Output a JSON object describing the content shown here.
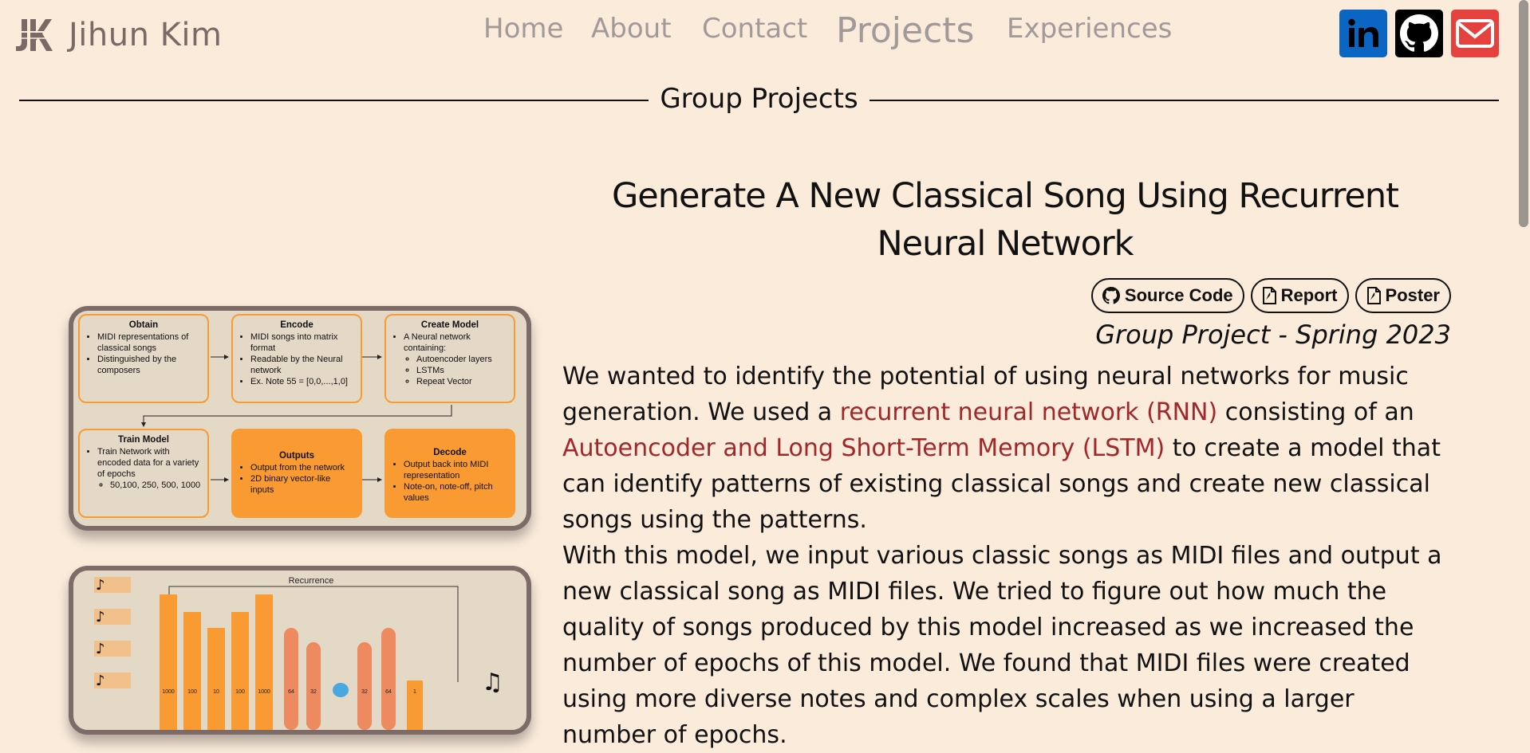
{
  "site": {
    "name": "Jihun Kim",
    "logo_text": "JK"
  },
  "nav": [
    {
      "label": "Home",
      "active": false
    },
    {
      "label": "About",
      "active": false
    },
    {
      "label": "Contact",
      "active": false
    },
    {
      "label": "Projects",
      "active": true
    },
    {
      "label": "Experiences",
      "active": false
    }
  ],
  "social": {
    "icons": [
      "linkedin-icon",
      "github-icon",
      "mail-icon"
    ],
    "colors": {
      "linkedin": "#0a66c2",
      "github": "#000000",
      "mail": "#e5413f"
    }
  },
  "section": {
    "title": "Group Projects"
  },
  "project": {
    "title": "Generate A New Classical Song Using Recurrent Neural Network",
    "buttons": [
      {
        "label": "Source Code",
        "icon": "github-icon"
      },
      {
        "label": "Report",
        "icon": "pdf-icon"
      },
      {
        "label": "Poster",
        "icon": "pdf-icon"
      }
    ],
    "subtitle": "Group Project - Spring 2023",
    "p1_a": "We wanted to identify the potential of using neural networks for music generation. We used a ",
    "p1_hl1": "recurrent neural network (RNN)",
    "p1_b": " consisting of an ",
    "p1_hl2": "Autoencoder and Long Short-Term Memory (LSTM)",
    "p1_c": " to create a model that can identify patterns of existing classical songs and create new classical songs using the patterns.",
    "p2": "With this model, we input various classic songs as MIDI files and output a new classical song as MIDI files. We tried to figure out how much the quality of songs produced by this model increased as we increased the number of epochs of this model. We found that MIDI files were created using more diverse notes and complex scales when using a larger number of epochs.",
    "accent_color": "#a0282a"
  },
  "flowchart": {
    "obtain": {
      "title": "Obtain",
      "items": [
        "MIDI representations of classical songs",
        "Distinguished by the composers"
      ]
    },
    "encode": {
      "title": "Encode",
      "items": [
        "MIDI songs into matrix format",
        "Readable by the Neural network",
        "Ex. Note 55 = [0,0,...,1,0]"
      ]
    },
    "create": {
      "title": "Create Model",
      "items": [
        "A Neural network containing:"
      ],
      "sub": [
        "Autoencoder layers",
        "LSTMs",
        "Repeat Vector"
      ]
    },
    "train": {
      "title": "Train Model",
      "items": [
        "Train Network with encoded data for a variety of epochs"
      ],
      "sub": [
        "50,100, 250, 500, 1000"
      ]
    },
    "outputs": {
      "title": "Outputs",
      "items": [
        "Output from the network",
        "2D binary vector-like inputs"
      ]
    },
    "decode": {
      "title": "Decode",
      "items": [
        "Output back into MIDI representation",
        "Note-on, note-off, pitch values"
      ]
    }
  },
  "network": {
    "recurrence_label": "Recurrence",
    "layers": [
      "1000",
      "100",
      "10",
      "100",
      "1000",
      "64",
      "32",
      "",
      "32",
      "64",
      "1"
    ]
  }
}
